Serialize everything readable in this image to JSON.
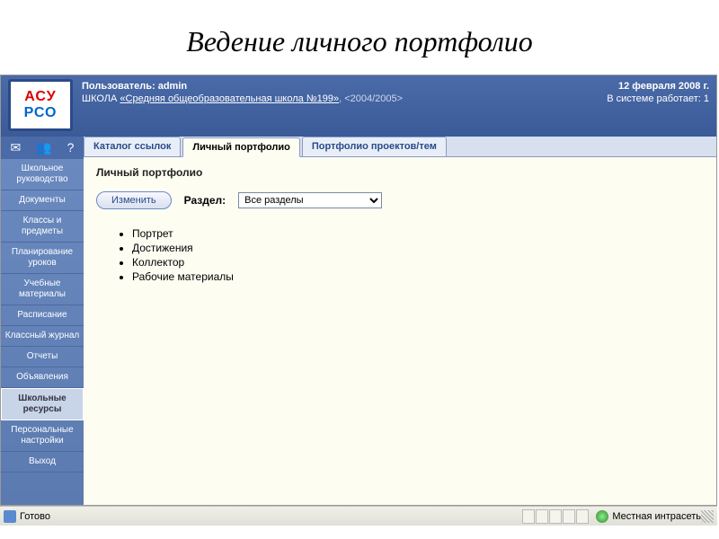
{
  "slide_title": "Ведение личного портфолио",
  "logo": {
    "top": "АСУ",
    "bottom": "РСО"
  },
  "header": {
    "user_label": "Пользователь: admin",
    "school_prefix": "ШКОЛА ",
    "school_link": "«Средняя общеобразовательная школа №199»",
    "school_year": ", <2004/2005>",
    "date": "12 февраля 2008 г.",
    "online_label": "В системе работает:",
    "online_count": "1"
  },
  "sidebar": {
    "items": [
      "Школьное руководство",
      "Документы",
      "Классы и предметы",
      "Планирование уроков",
      "Учебные материалы",
      "Расписание",
      "Классный журнал",
      "Отчеты",
      "Объявления",
      "Школьные ресурсы",
      "Персональные настройки",
      "Выход"
    ],
    "active_index": 9
  },
  "tabs": {
    "items": [
      "Каталог ссылок",
      "Личный портфолио",
      "Портфолио проектов/тем"
    ],
    "active_index": 1
  },
  "page": {
    "heading": "Личный портфолио",
    "edit_button": "Изменить",
    "section_label": "Раздел:",
    "section_select": {
      "value": "Все разделы",
      "options": [
        "Все разделы"
      ]
    },
    "bullets": [
      "Портрет",
      "Достижения",
      "Коллектор",
      "Рабочие материалы"
    ]
  },
  "statusbar": {
    "status_text": "Готово",
    "zone_text": "Местная интрасеть"
  }
}
